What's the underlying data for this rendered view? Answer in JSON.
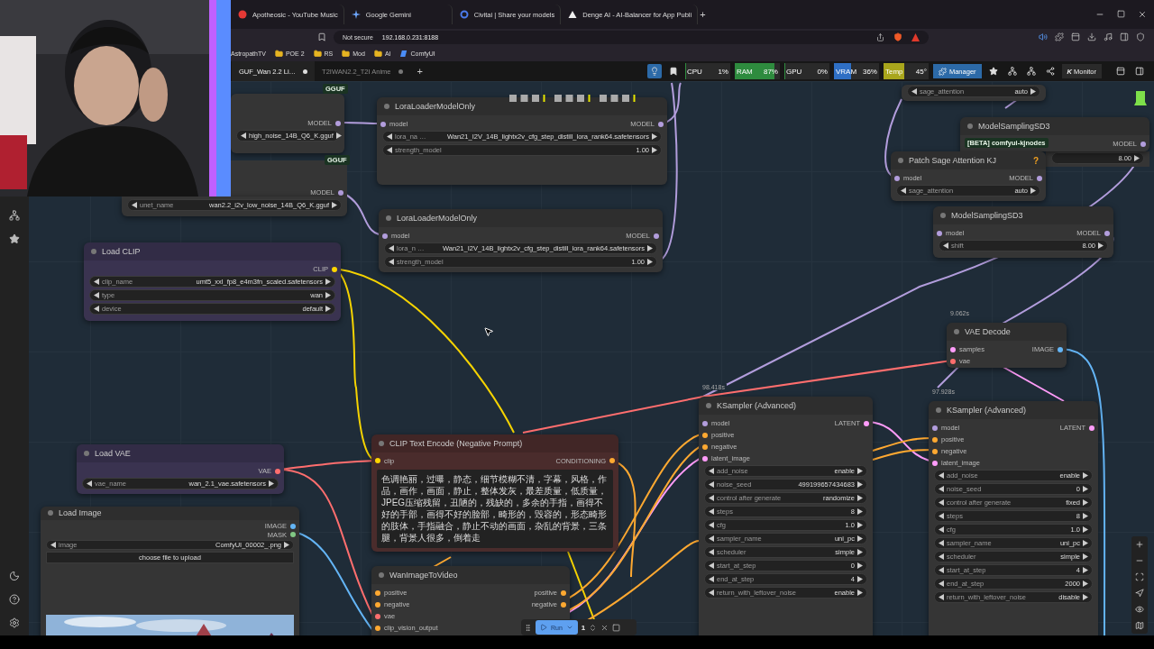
{
  "browser": {
    "tabs": [
      {
        "title": "Apotheosic - YouTube Music",
        "selected": false,
        "kind": "music"
      },
      {
        "title": "Google Gemini",
        "selected": false,
        "kind": "star"
      },
      {
        "title": "Civitai | Share your models",
        "selected": false,
        "kind": "ring"
      },
      {
        "title": "Denge AI - AI-Balancer for App Publi",
        "selected": false,
        "kind": "triangle"
      }
    ],
    "new_tab": "+",
    "security": "Not secure",
    "url": "192.168.0.231:8188",
    "bookmarks": [
      {
        "label": "AstropathTV",
        "kind": "link"
      },
      {
        "label": "POE 2",
        "kind": "folder"
      },
      {
        "label": "RS",
        "kind": "folder"
      },
      {
        "label": "Mod",
        "kind": "folder"
      },
      {
        "label": "AI",
        "kind": "folder"
      },
      {
        "label": "ComfyUI",
        "kind": "app"
      }
    ]
  },
  "workflow_tabs": [
    {
      "title": "GUF_Wan 2.2 Li…",
      "selected": true,
      "unsaved": true
    },
    {
      "title": "T2IWAN2.2_T2I Anime",
      "selected": false,
      "unsaved": true
    }
  ],
  "new_workflow": "+",
  "monitors": [
    {
      "label": "CPU",
      "reading": "1%",
      "level": 0.01,
      "color": "#2e8b3e"
    },
    {
      "label": "RAM",
      "reading": "87%",
      "level": 0.87,
      "color": "#2e8b3e"
    },
    {
      "label": "GPU",
      "reading": "0%",
      "level": 0,
      "color": "#2e8b3e"
    },
    {
      "label": "VRAM",
      "reading": "36%",
      "level": 0.36,
      "color": "#2f6fc4"
    },
    {
      "label": "Temp",
      "reading": "45°",
      "level": 0.45,
      "color": "#a9a61c"
    }
  ],
  "manager": "Manager",
  "monitor_logo": "K",
  "monitor": "Monitor",
  "nodes": [
    {
      "color": "#353535",
      "badge": "GGUF",
      "outputs": [
        {
          "name": "MODEL",
          "color": "#b29ddc"
        }
      ],
      "widgets": [
        {
          "value": "high_noise_14B_Q6_K.gguf"
        }
      ]
    },
    {
      "color": "#353535",
      "badge": "GGUF",
      "outputs": [
        {
          "name": "MODEL",
          "color": "#b29ddc"
        }
      ],
      "widgets": [
        {
          "label": "unet_name",
          "value": "wan2.2_i2v_low_noise_14B_Q6_K.gguf"
        }
      ]
    },
    {
      "title": "LoraLoaderModelOnly",
      "color": "#353535",
      "inputs": [
        {
          "name": "model",
          "color": "#b29ddc"
        }
      ],
      "outputs": [
        {
          "name": "MODEL",
          "color": "#b29ddc"
        }
      ],
      "widgets": [
        {
          "label": "lora_na …",
          "value": "Wan21_I2V_14B_lightx2v_cfg_step_distill_lora_rank64.safetensors"
        },
        {
          "label": "strength_model",
          "value": "1.00"
        }
      ]
    },
    {
      "title": "LoraLoaderModelOnly",
      "color": "#353535",
      "inputs": [
        {
          "name": "model",
          "color": "#b29ddc"
        }
      ],
      "outputs": [
        {
          "name": "MODEL",
          "color": "#b29ddc"
        }
      ],
      "widgets": [
        {
          "label": "lora_n …",
          "value": "Wan21_I2V_14B_lightx2v_cfg_step_distill_lora_rank64.safetensors"
        },
        {
          "label": "strength_model",
          "value": "1.00"
        }
      ]
    },
    {
      "title": "Load CLIP",
      "color": "#3a3350",
      "outputs": [
        {
          "name": "CLIP",
          "color": "#ffd500"
        }
      ],
      "widgets": [
        {
          "label": "clip_name",
          "value": "umt5_xxl_fp8_e4m3fn_scaled.safetensors"
        },
        {
          "label": "type",
          "value": "wan"
        },
        {
          "label": "device",
          "value": "default"
        }
      ]
    },
    {
      "color": "#353535",
      "widgets": [
        {
          "label": "sage_attention",
          "value": "auto"
        }
      ]
    },
    {
      "title": "ModelSamplingSD3",
      "color": "#353535",
      "outputs": [
        {
          "name": "MODEL",
          "color": "#b29ddc"
        }
      ],
      "widgets": [
        {
          "value": "8.00"
        }
      ]
    },
    {
      "title": "Patch Sage Attention KJ",
      "color": "#353535",
      "badge": "[BETA] comfyui-kjnodes",
      "help": "?",
      "inputs": [
        {
          "name": "model",
          "color": "#b29ddc"
        }
      ],
      "outputs": [
        {
          "name": "MODEL",
          "color": "#b29ddc"
        }
      ],
      "widgets": [
        {
          "label": "sage_attention",
          "value": "auto"
        }
      ]
    },
    {
      "title": "ModelSamplingSD3",
      "color": "#353535",
      "inputs": [
        {
          "name": "model",
          "color": "#b29ddc"
        }
      ],
      "outputs": [
        {
          "name": "MODEL",
          "color": "#b29ddc"
        }
      ],
      "widgets": [
        {
          "label": "shift",
          "value": "8.00"
        }
      ]
    },
    {
      "title": "VAE Decode",
      "color": "#353535",
      "time": "9.062s",
      "inputs": [
        {
          "name": "samples",
          "color": "#ff9cf9"
        },
        {
          "name": "vae",
          "color": "#ff6e6e"
        }
      ],
      "outputs": [
        {
          "name": "IMAGE",
          "color": "#64b5f6"
        }
      ]
    },
    {
      "title": "KSampler (Advanced)",
      "color": "#353535",
      "time": "98.418s",
      "inputs": [
        {
          "name": "model",
          "color": "#b29ddc"
        },
        {
          "name": "positive",
          "color": "#ffa931"
        },
        {
          "name": "negative",
          "color": "#ffa931"
        },
        {
          "name": "latent_image",
          "color": "#ff9cf9"
        }
      ],
      "outputs": [
        {
          "name": "LATENT",
          "color": "#ff9cf9"
        }
      ],
      "widgets": [
        {
          "label": "add_noise",
          "value": "enable"
        },
        {
          "label": "noise_seed",
          "value": "499199657434683"
        },
        {
          "label": "control after generate",
          "value": "randomize"
        },
        {
          "label": "steps",
          "value": "8"
        },
        {
          "label": "cfg",
          "value": "1.0"
        },
        {
          "label": "sampler_name",
          "value": "uni_pc"
        },
        {
          "label": "scheduler",
          "value": "simple"
        },
        {
          "label": "start_at_step",
          "value": "0"
        },
        {
          "label": "end_at_step",
          "value": "4"
        },
        {
          "label": "return_with_leftover_noise",
          "value": "enable"
        }
      ]
    },
    {
      "title": "KSampler (Advanced)",
      "color": "#353535",
      "time": "97.928s",
      "inputs": [
        {
          "name": "model",
          "color": "#b29ddc"
        },
        {
          "name": "positive",
          "color": "#ffa931"
        },
        {
          "name": "negative",
          "color": "#ffa931"
        },
        {
          "name": "latent_image",
          "color": "#ff9cf9"
        }
      ],
      "outputs": [
        {
          "name": "LATENT",
          "color": "#ff9cf9"
        }
      ],
      "widgets": [
        {
          "label": "add_noise",
          "value": "enable"
        },
        {
          "label": "noise_seed",
          "value": "0"
        },
        {
          "label": "control after generate",
          "value": "fixed"
        },
        {
          "label": "steps",
          "value": "8"
        },
        {
          "label": "cfg",
          "value": "1.0"
        },
        {
          "label": "sampler_name",
          "value": "uni_pc"
        },
        {
          "label": "scheduler",
          "value": "simple"
        },
        {
          "label": "start_at_step",
          "value": "4"
        },
        {
          "label": "end_at_step",
          "value": "2000"
        },
        {
          "label": "return_with_leftover_noise",
          "value": "disable"
        }
      ]
    },
    {
      "title": "Load VAE",
      "color": "#3a3350",
      "outputs": [
        {
          "name": "VAE",
          "color": "#ff6e6e"
        }
      ],
      "widgets": [
        {
          "label": "vae_name",
          "value": "wan_2.1_vae.safetensors"
        }
      ]
    },
    {
      "title": "Load Image",
      "color": "#353535",
      "outputs": [
        {
          "name": "IMAGE",
          "color": "#64b5f6"
        },
        {
          "name": "MASK",
          "color": "#81c784"
        }
      ],
      "widgets": [
        {
          "label": "image",
          "value": "ComfyUI_00002_.png"
        }
      ],
      "button": "choose file to upload",
      "preview": {
        "kind": "picture"
      }
    },
    {
      "title": "CLIP Text Encode (Negative Prompt)",
      "color": "#4a2c2c",
      "inputs": [
        {
          "name": "clip",
          "color": "#ffd500"
        }
      ],
      "outputs": [
        {
          "name": "CONDITIONING",
          "color": "#ffa931"
        }
      ],
      "prompt": "色调艳丽，过曝，静态，细节模糊不清，字幕，风格，作品，画作，画面，静止，整体发灰，最差质量，低质量，JPEG压缩残留，丑陋的，残缺的，多余的手指，画得不好的手部，画得不好的脸部，畸形的，毁容的，形态畸形的肢体，手指融合，静止不动的画面，杂乱的背景，三条腿，背景人很多，倒着走"
    },
    {
      "title": "WanImageToVideo",
      "color": "#353535",
      "inputs": [
        {
          "name": "positive",
          "color": "#ffa931"
        },
        {
          "name": "negative",
          "color": "#ffa931"
        },
        {
          "name": "vae",
          "color": "#ff6e6e"
        },
        {
          "name": "clip_vision_output",
          "color": "#ffa931"
        }
      ],
      "outputs": [
        {
          "name": "positive",
          "color": "#ffa931"
        },
        {
          "name": "negative",
          "color": "#ffa931"
        }
      ]
    }
  ],
  "run_bar": {
    "run": "Run",
    "count": "1"
  }
}
